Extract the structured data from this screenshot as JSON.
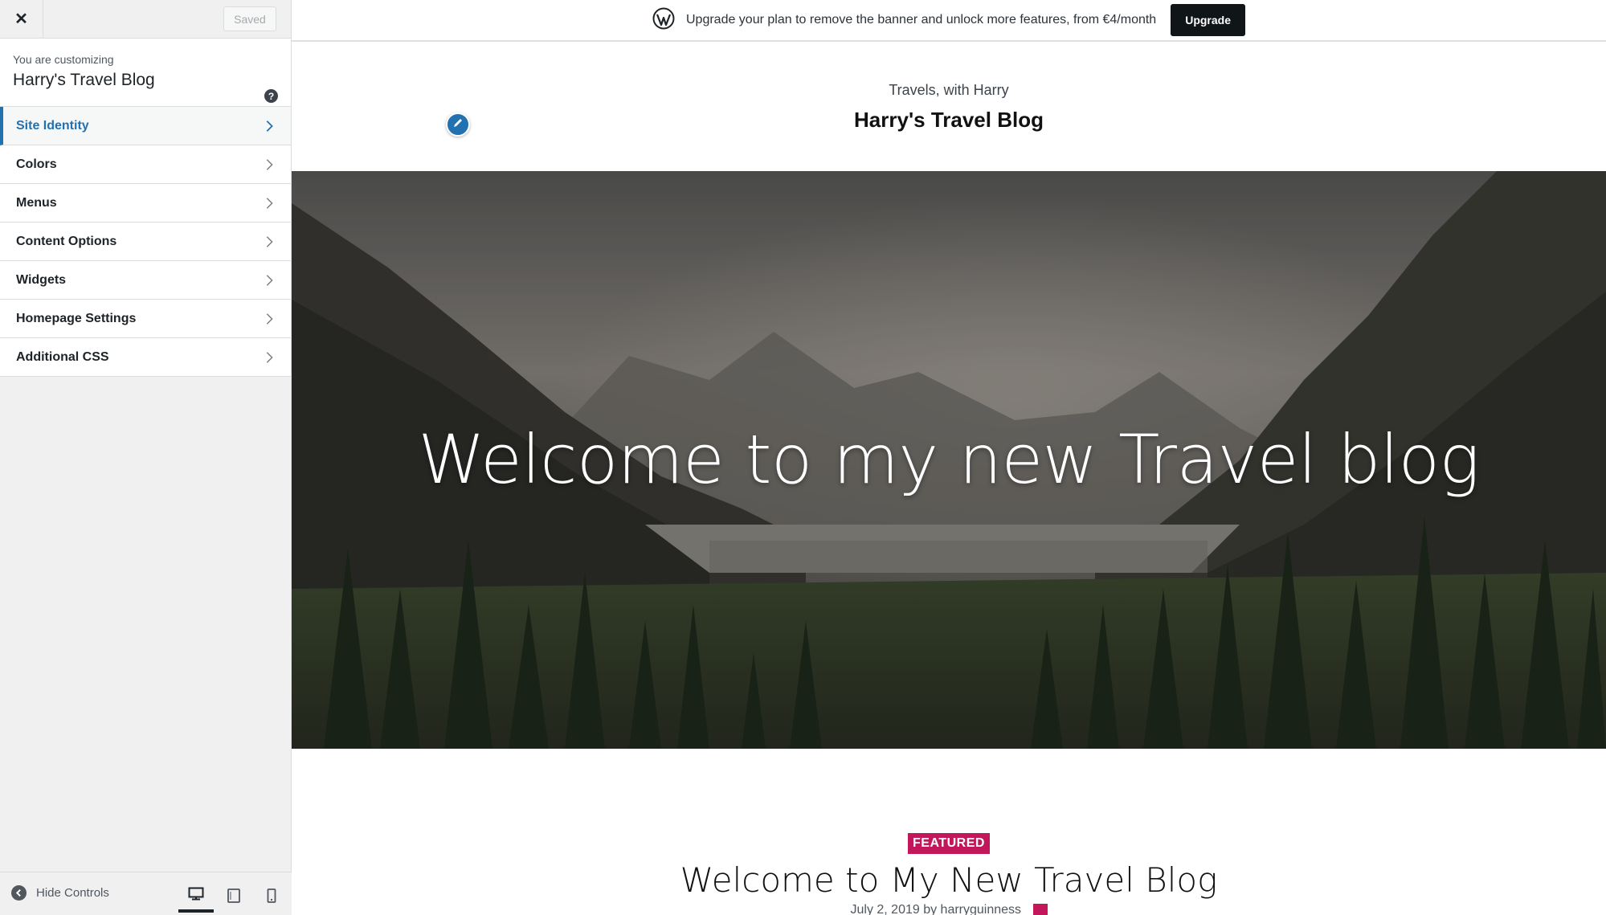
{
  "sidebar": {
    "close_icon": "close-icon",
    "saved_label": "Saved",
    "customizing_label": "You are customizing",
    "site_title": "Harry's Travel Blog",
    "help_icon": "?",
    "sections": [
      {
        "label": "Site Identity",
        "active": true
      },
      {
        "label": "Colors"
      },
      {
        "label": "Menus"
      },
      {
        "label": "Content Options"
      },
      {
        "label": "Widgets"
      },
      {
        "label": "Homepage Settings"
      },
      {
        "label": "Additional CSS"
      }
    ],
    "footer": {
      "hide_controls": "Hide Controls",
      "devices": [
        "desktop",
        "tablet",
        "mobile"
      ],
      "active_device": "desktop"
    }
  },
  "banner": {
    "text": "Upgrade your plan to remove the banner and unlock more features, from €4/month",
    "button": "Upgrade"
  },
  "site": {
    "tagline": "Travels, with Harry",
    "title": "Harry's Travel Blog"
  },
  "hero": {
    "title": "Welcome to my new Travel blog"
  },
  "post": {
    "badge": "FEATURED",
    "title": "Welcome to My New Travel Blog",
    "meta": "July 2, 2019 by harryguinness"
  },
  "colors": {
    "accent": "#2271b1",
    "featured": "#c2185b",
    "upgrade_button": "#101517"
  }
}
